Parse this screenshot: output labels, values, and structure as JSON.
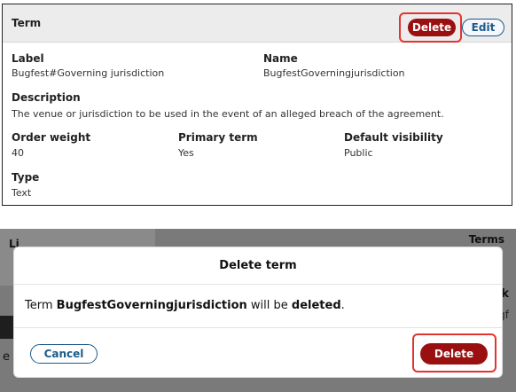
{
  "term_panel": {
    "title": "Term",
    "delete_label": "Delete",
    "edit_label": "Edit",
    "fields": {
      "label_title": "Label",
      "label_value": "Bugfest#Governing jurisdiction",
      "name_title": "Name",
      "name_value": "BugfestGoverningjurisdiction",
      "description_title": "Description",
      "description_value": "The venue or jurisdiction to be used in the event of an alleged breach of the agreement.",
      "order_weight_title": "Order weight",
      "order_weight_value": "40",
      "primary_term_title": "Primary term",
      "primary_term_value": "Yes",
      "default_visibility_title": "Default visibility",
      "default_visibility_value": "Public",
      "type_title": "Type",
      "type_value": "Text"
    }
  },
  "background": {
    "left_partial_text": "Li",
    "right_partial_text_top": "Terms",
    "right_partial_letter": "k",
    "right_partial_letter2": "gf",
    "left_partial_letter": "e"
  },
  "modal": {
    "title": "Delete term",
    "body_prefix": "Term ",
    "term_name": "BugfestGoverningjurisdiction",
    "body_middle": " will be ",
    "body_action": "deleted",
    "body_suffix": ".",
    "cancel_label": "Cancel",
    "delete_label": "Delete"
  },
  "colors": {
    "danger": "#9a0f0f",
    "primary": "#1c5a8a",
    "highlight": "#e3342f"
  }
}
